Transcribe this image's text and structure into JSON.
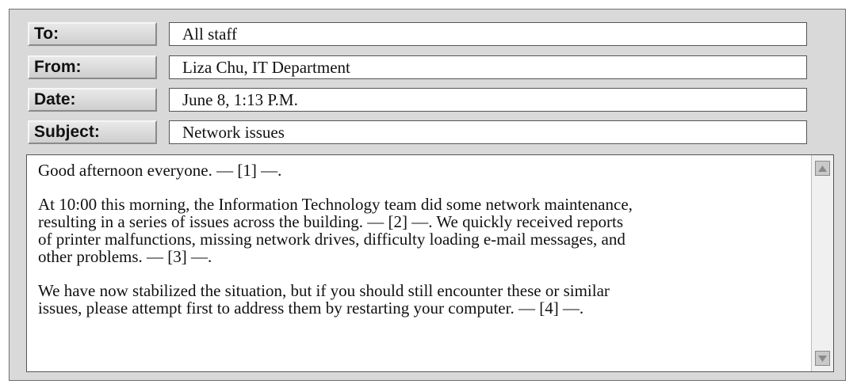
{
  "header": {
    "to_label": "To:",
    "to_value": "All staff",
    "from_label": "From:",
    "from_value": "Liza Chu, IT Department",
    "date_label": "Date:",
    "date_value": "June 8, 1:13 P.M.",
    "subject_label": "Subject:",
    "subject_value": "Network issues"
  },
  "body": {
    "paragraphs": [
      "Good afternoon everyone. — [1] —.",
      "At 10:00 this morning, the Information Technology team did some network maintenance,\nresulting in a series of issues across the building. — [2] —. We quickly received reports\nof printer malfunctions, missing network drives, difficulty loading e-mail messages, and\nother problems. — [3] —.",
      "We have now stabilized the situation, but if you should still encounter these or similar\nissues, please attempt first to address them by restarting your computer. — [4] —."
    ]
  },
  "icons": {
    "scroll_up": "triangle-up-icon",
    "scroll_down": "triangle-down-icon"
  },
  "colors": {
    "window_bg": "#d9d9d9",
    "field_bg": "#ffffff",
    "scroll_arrow": "#8a8a8a"
  }
}
